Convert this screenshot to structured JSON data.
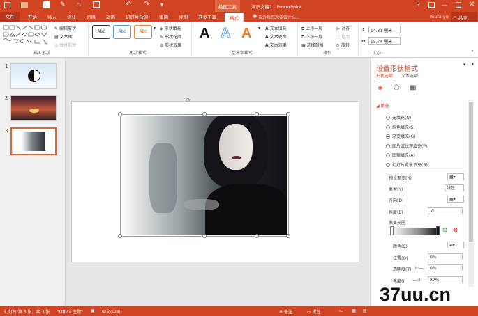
{
  "titlebar": {
    "context_tab": "绘图工具",
    "doc_title": "演示文稿1 - PowerPoint",
    "help": "?"
  },
  "tabs": {
    "file": "文件",
    "items": [
      "开始",
      "插入",
      "设计",
      "切换",
      "动画",
      "幻灯片放映",
      "审阅",
      "视图",
      "开发工具"
    ],
    "format": "格式",
    "search_placeholder": "告诉我您想要做什么...",
    "user": "mufa yu",
    "share": "共享"
  },
  "ribbon": {
    "insert_shapes": {
      "edit_shape": "编辑形状",
      "text_box": "文本框",
      "merge_shapes": "合并形状",
      "label": "插入形状"
    },
    "shape_styles": {
      "preset": "Abc",
      "fill": "形状填充",
      "outline": "形状轮廓",
      "effects": "形状效果",
      "label": "形状样式"
    },
    "wordart": {
      "letter": "A",
      "text_fill": "文本填充",
      "text_outline": "文本轮廓",
      "text_effects": "文本效果",
      "label": "艺术字样式"
    },
    "arrange": {
      "forward": "上移一层",
      "backward": "下移一层",
      "selection_pane": "选择窗格",
      "align": "对齐",
      "group": "组合",
      "rotate": "旋转",
      "label": "排列"
    },
    "size": {
      "height": "14.31 厘米",
      "width": "15.74 厘米",
      "label": "大小"
    }
  },
  "thumbnails": [
    {
      "num": "1"
    },
    {
      "num": "2"
    },
    {
      "num": "3"
    }
  ],
  "pane": {
    "title": "设置形状格式",
    "tab_shape": "形状选项",
    "tab_text": "文本选项",
    "section": "填充",
    "options": [
      "无填充(N)",
      "纯色填充(S)",
      "渐变填充(G)",
      "图片或纹理填充(P)",
      "图案填充(A)",
      "幻灯片背景填充(B)"
    ],
    "selected_index": 2,
    "preset_label": "预设渐变(R)",
    "type_label": "类型(Y)",
    "type_value": "线性",
    "direction_label": "方向(D)",
    "angle_label": "角度(E)",
    "angle_value": ".0°",
    "stops_label": "渐变光圈",
    "color_label": "颜色(C)",
    "position_label": "位置(O)",
    "position_value": "0%",
    "transparency_label": "透明度(T)",
    "transparency_value": "0%",
    "brightness_label": "亮度(I)",
    "brightness_value": "82%"
  },
  "status": {
    "slide_info": "幻灯片 第 3 张，共 3 张",
    "theme": "\"Office 主题\"",
    "language": "中文(中国)",
    "notes": "备注",
    "comments": "批注"
  },
  "watermark": "37uu.cn",
  "colors": {
    "accent": "#d04424",
    "ribbon_bg": "#ffffff",
    "pane_title": "#d04424"
  }
}
